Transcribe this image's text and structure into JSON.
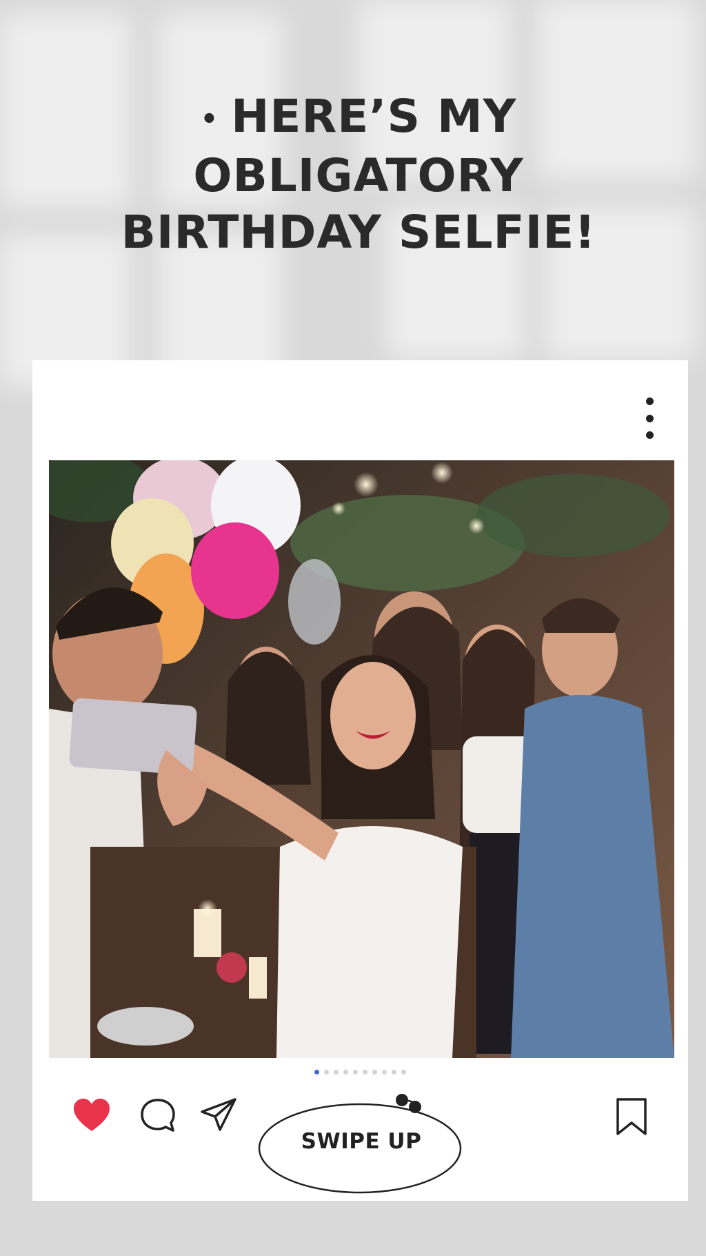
{
  "headline": {
    "line1": "HERE’S MY OBLIGATORY",
    "line2": "BIRTHDAY SELFIE!"
  },
  "post": {
    "photo_alt": "",
    "carousel": {
      "count": 10,
      "active_index": 0
    },
    "action_icons": [
      "heart-icon",
      "comment-icon",
      "share-icon",
      "bookmark-icon"
    ],
    "swipe_label": "SWIPE UP"
  },
  "colors": {
    "background": "#d9d9d9",
    "card": "#ffffff",
    "heart": "#e8334b",
    "text": "#2a2a2a",
    "carousel_active": "#3b6bd1"
  }
}
